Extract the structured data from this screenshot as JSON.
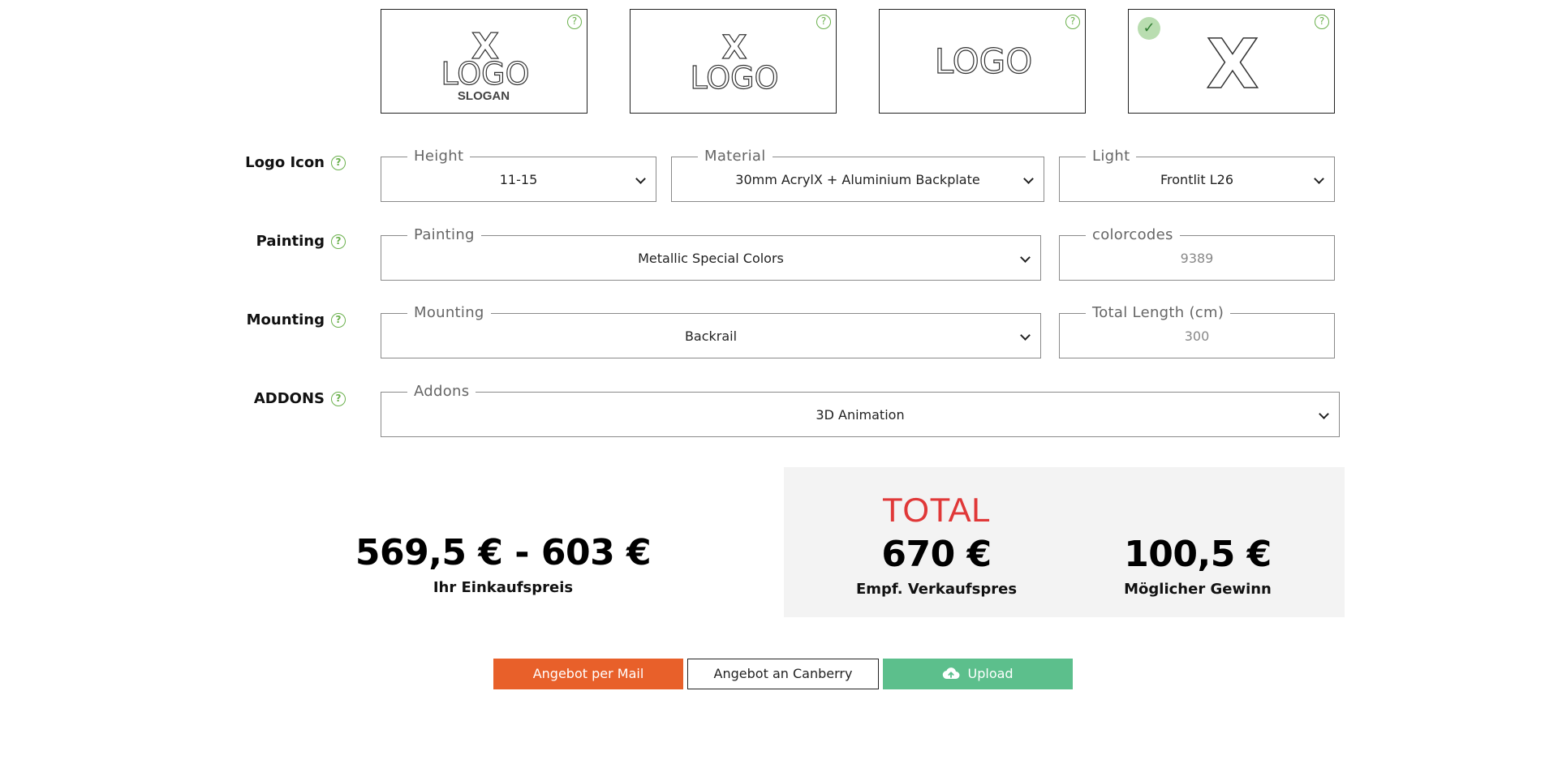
{
  "option_cards": [
    {
      "name": "x-logo-slogan",
      "icon": "x-logo-slogan-preview",
      "selected": false,
      "help": "?"
    },
    {
      "name": "x-logo",
      "icon": "x-logo-preview",
      "selected": false,
      "help": "?"
    },
    {
      "name": "logo",
      "icon": "logo-preview",
      "selected": false,
      "help": "?"
    },
    {
      "name": "x",
      "icon": "x-preview",
      "selected": true,
      "help": "?"
    }
  ],
  "card_texts": {
    "x": "X",
    "logo": "LOGO",
    "slogan": "SLOGAN"
  },
  "rows": {
    "logo_icon": {
      "label": "Logo Icon",
      "height": {
        "legend": "Height",
        "value": "11-15"
      },
      "material": {
        "legend": "Material",
        "value": "30mm AcrylX + Aluminium Backplate"
      },
      "light": {
        "legend": "Light",
        "value": "Frontlit L26"
      }
    },
    "painting": {
      "label": "Painting",
      "painting": {
        "legend": "Painting",
        "value": "Metallic Special Colors"
      },
      "colorcodes": {
        "legend": "colorcodes",
        "value": "9389"
      }
    },
    "mounting": {
      "label": "Mounting",
      "mounting": {
        "legend": "Mounting",
        "value": "Backrail"
      },
      "total_length": {
        "legend": "Total Length (cm)",
        "value": "300"
      }
    },
    "addons": {
      "label": "ADDONS",
      "addons": {
        "legend": "Addons",
        "value": "3D Animation"
      }
    }
  },
  "help_glyph": "?",
  "prices": {
    "purchase": {
      "value": "569,5 € - 603 €",
      "label": "Ihr Einkaufspreis"
    },
    "total_title": "TOTAL",
    "retail": {
      "value": "670 €",
      "label": "Empf. Verkaufspres"
    },
    "profit": {
      "value": "100,5 €",
      "label": "Möglicher Gewinn"
    }
  },
  "buttons": {
    "mail": "Angebot per Mail",
    "canberry": "Angebot an Canberry",
    "upload": "Upload"
  },
  "colors": {
    "accent_green": "#6ab04c",
    "total_red": "#e03838",
    "mail_orange": "#e8602a",
    "upload_green": "#5cbf8c"
  }
}
